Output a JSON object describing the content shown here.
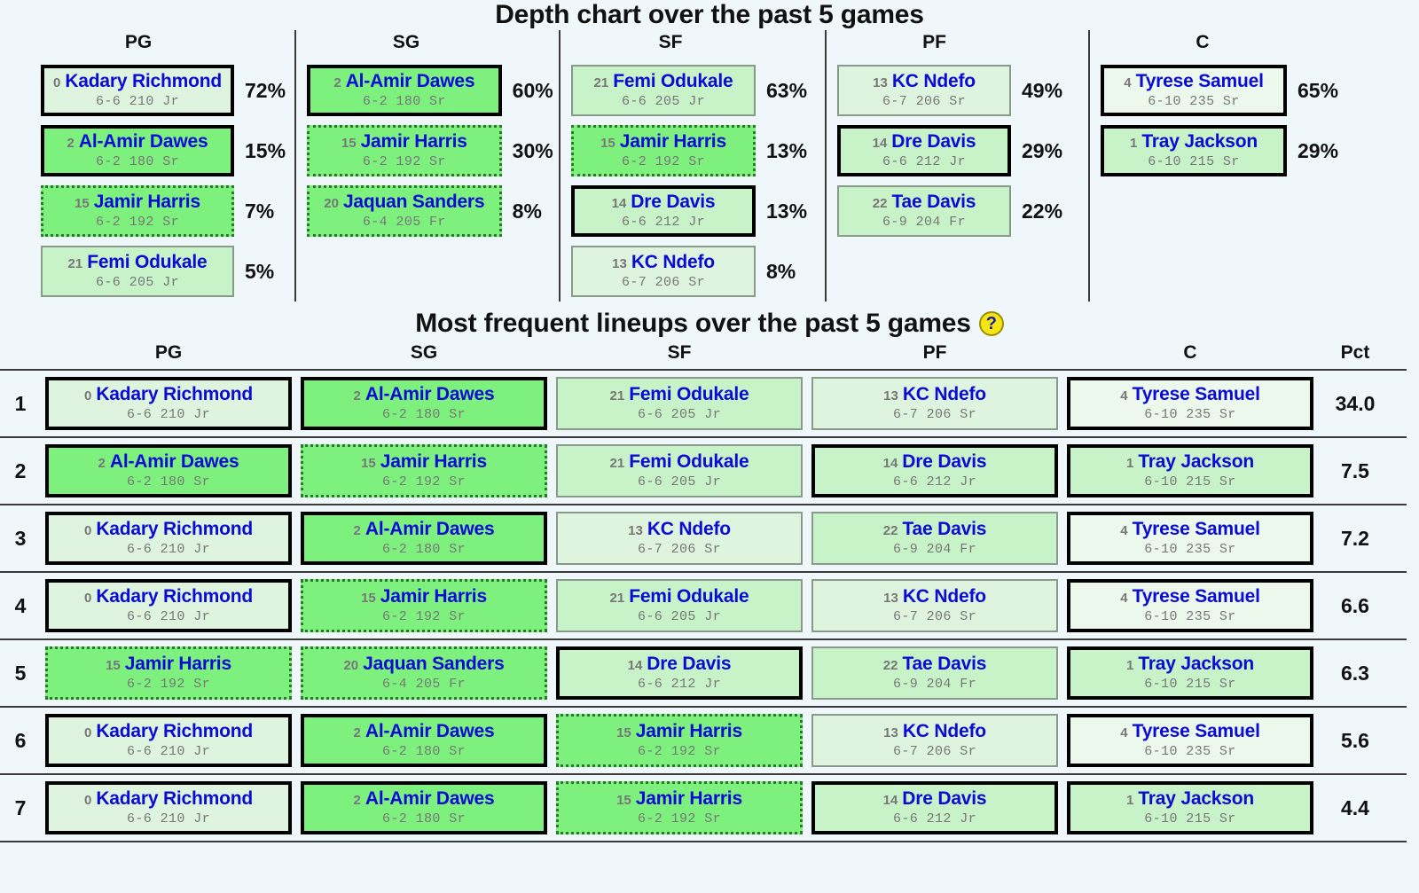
{
  "depth": {
    "title": "Depth chart over the past 5 games",
    "columns": [
      {
        "label": "PG",
        "players": [
          {
            "num": "0",
            "name": "Kadary Richmond",
            "detail": "6-6 210 Jr",
            "pct": "72%",
            "border": "bd-thick",
            "fill": "fill-1"
          },
          {
            "num": "2",
            "name": "Al-Amir Dawes",
            "detail": "6-2 180 Sr",
            "pct": "15%",
            "border": "bd-thick",
            "fill": "fill-3"
          },
          {
            "num": "15",
            "name": "Jamir Harris",
            "detail": "6-2 192 Sr",
            "pct": "7%",
            "border": "bd-dot",
            "fill": "fill-3"
          },
          {
            "num": "21",
            "name": "Femi Odukale",
            "detail": "6-6 205 Jr",
            "pct": "5%",
            "border": "bd-thin",
            "fill": "fill-2"
          }
        ]
      },
      {
        "label": "SG",
        "players": [
          {
            "num": "2",
            "name": "Al-Amir Dawes",
            "detail": "6-2 180 Sr",
            "pct": "60%",
            "border": "bd-thick",
            "fill": "fill-3"
          },
          {
            "num": "15",
            "name": "Jamir Harris",
            "detail": "6-2 192 Sr",
            "pct": "30%",
            "border": "bd-dot",
            "fill": "fill-3"
          },
          {
            "num": "20",
            "name": "Jaquan Sanders",
            "detail": "6-4 205 Fr",
            "pct": "8%",
            "border": "bd-dot",
            "fill": "fill-3"
          }
        ]
      },
      {
        "label": "SF",
        "players": [
          {
            "num": "21",
            "name": "Femi Odukale",
            "detail": "6-6 205 Jr",
            "pct": "63%",
            "border": "bd-thin",
            "fill": "fill-2"
          },
          {
            "num": "15",
            "name": "Jamir Harris",
            "detail": "6-2 192 Sr",
            "pct": "13%",
            "border": "bd-dot",
            "fill": "fill-3"
          },
          {
            "num": "14",
            "name": "Dre Davis",
            "detail": "6-6 212 Jr",
            "pct": "13%",
            "border": "bd-thick",
            "fill": "fill-2"
          },
          {
            "num": "13",
            "name": "KC Ndefo",
            "detail": "6-7 206 Sr",
            "pct": "8%",
            "border": "bd-thin",
            "fill": "fill-1"
          }
        ]
      },
      {
        "label": "PF",
        "players": [
          {
            "num": "13",
            "name": "KC Ndefo",
            "detail": "6-7 206 Sr",
            "pct": "49%",
            "border": "bd-thin",
            "fill": "fill-1"
          },
          {
            "num": "14",
            "name": "Dre Davis",
            "detail": "6-6 212 Jr",
            "pct": "29%",
            "border": "bd-thick",
            "fill": "fill-2"
          },
          {
            "num": "22",
            "name": "Tae Davis",
            "detail": "6-9 204 Fr",
            "pct": "22%",
            "border": "bd-thin",
            "fill": "fill-2"
          }
        ]
      },
      {
        "label": "C",
        "players": [
          {
            "num": "4",
            "name": "Tyrese Samuel",
            "detail": "6-10 235 Sr",
            "pct": "65%",
            "border": "bd-thick",
            "fill": "fill-0"
          },
          {
            "num": "1",
            "name": "Tray Jackson",
            "detail": "6-10 215 Sr",
            "pct": "29%",
            "border": "bd-thick",
            "fill": "fill-2"
          }
        ]
      }
    ]
  },
  "lineups": {
    "title": "Most frequent lineups over the past 5 games",
    "help_icon": "question-mark-icon",
    "help_label": "?",
    "headers": [
      "PG",
      "SG",
      "SF",
      "PF",
      "C"
    ],
    "pct_header": "Pct",
    "rows": [
      {
        "rank": "1",
        "pct": "34.0",
        "slots": [
          {
            "num": "0",
            "name": "Kadary Richmond",
            "detail": "6-6 210 Jr",
            "border": "bd-thick",
            "fill": "fill-1"
          },
          {
            "num": "2",
            "name": "Al-Amir Dawes",
            "detail": "6-2 180 Sr",
            "border": "bd-thick",
            "fill": "fill-3"
          },
          {
            "num": "21",
            "name": "Femi Odukale",
            "detail": "6-6 205 Jr",
            "border": "bd-thin",
            "fill": "fill-2"
          },
          {
            "num": "13",
            "name": "KC Ndefo",
            "detail": "6-7 206 Sr",
            "border": "bd-thin",
            "fill": "fill-1"
          },
          {
            "num": "4",
            "name": "Tyrese Samuel",
            "detail": "6-10 235 Sr",
            "border": "bd-thick",
            "fill": "fill-0"
          }
        ]
      },
      {
        "rank": "2",
        "pct": "7.5",
        "slots": [
          {
            "num": "2",
            "name": "Al-Amir Dawes",
            "detail": "6-2 180 Sr",
            "border": "bd-thick",
            "fill": "fill-3"
          },
          {
            "num": "15",
            "name": "Jamir Harris",
            "detail": "6-2 192 Sr",
            "border": "bd-dot",
            "fill": "fill-3"
          },
          {
            "num": "21",
            "name": "Femi Odukale",
            "detail": "6-6 205 Jr",
            "border": "bd-thin",
            "fill": "fill-2"
          },
          {
            "num": "14",
            "name": "Dre Davis",
            "detail": "6-6 212 Jr",
            "border": "bd-thick",
            "fill": "fill-2"
          },
          {
            "num": "1",
            "name": "Tray Jackson",
            "detail": "6-10 215 Sr",
            "border": "bd-thick",
            "fill": "fill-2"
          }
        ]
      },
      {
        "rank": "3",
        "pct": "7.2",
        "slots": [
          {
            "num": "0",
            "name": "Kadary Richmond",
            "detail": "6-6 210 Jr",
            "border": "bd-thick",
            "fill": "fill-1"
          },
          {
            "num": "2",
            "name": "Al-Amir Dawes",
            "detail": "6-2 180 Sr",
            "border": "bd-thick",
            "fill": "fill-3"
          },
          {
            "num": "13",
            "name": "KC Ndefo",
            "detail": "6-7 206 Sr",
            "border": "bd-thin",
            "fill": "fill-1"
          },
          {
            "num": "22",
            "name": "Tae Davis",
            "detail": "6-9 204 Fr",
            "border": "bd-thin",
            "fill": "fill-2"
          },
          {
            "num": "4",
            "name": "Tyrese Samuel",
            "detail": "6-10 235 Sr",
            "border": "bd-thick",
            "fill": "fill-0"
          }
        ]
      },
      {
        "rank": "4",
        "pct": "6.6",
        "slots": [
          {
            "num": "0",
            "name": "Kadary Richmond",
            "detail": "6-6 210 Jr",
            "border": "bd-thick",
            "fill": "fill-1"
          },
          {
            "num": "15",
            "name": "Jamir Harris",
            "detail": "6-2 192 Sr",
            "border": "bd-dot",
            "fill": "fill-3"
          },
          {
            "num": "21",
            "name": "Femi Odukale",
            "detail": "6-6 205 Jr",
            "border": "bd-thin",
            "fill": "fill-2"
          },
          {
            "num": "13",
            "name": "KC Ndefo",
            "detail": "6-7 206 Sr",
            "border": "bd-thin",
            "fill": "fill-1"
          },
          {
            "num": "4",
            "name": "Tyrese Samuel",
            "detail": "6-10 235 Sr",
            "border": "bd-thick",
            "fill": "fill-0"
          }
        ]
      },
      {
        "rank": "5",
        "pct": "6.3",
        "slots": [
          {
            "num": "15",
            "name": "Jamir Harris",
            "detail": "6-2 192 Sr",
            "border": "bd-dot",
            "fill": "fill-3"
          },
          {
            "num": "20",
            "name": "Jaquan Sanders",
            "detail": "6-4 205 Fr",
            "border": "bd-dot",
            "fill": "fill-3"
          },
          {
            "num": "14",
            "name": "Dre Davis",
            "detail": "6-6 212 Jr",
            "border": "bd-thick",
            "fill": "fill-2"
          },
          {
            "num": "22",
            "name": "Tae Davis",
            "detail": "6-9 204 Fr",
            "border": "bd-thin",
            "fill": "fill-2"
          },
          {
            "num": "1",
            "name": "Tray Jackson",
            "detail": "6-10 215 Sr",
            "border": "bd-thick",
            "fill": "fill-2"
          }
        ]
      },
      {
        "rank": "6",
        "pct": "5.6",
        "slots": [
          {
            "num": "0",
            "name": "Kadary Richmond",
            "detail": "6-6 210 Jr",
            "border": "bd-thick",
            "fill": "fill-1"
          },
          {
            "num": "2",
            "name": "Al-Amir Dawes",
            "detail": "6-2 180 Sr",
            "border": "bd-thick",
            "fill": "fill-3"
          },
          {
            "num": "15",
            "name": "Jamir Harris",
            "detail": "6-2 192 Sr",
            "border": "bd-dot",
            "fill": "fill-3"
          },
          {
            "num": "13",
            "name": "KC Ndefo",
            "detail": "6-7 206 Sr",
            "border": "bd-thin",
            "fill": "fill-1"
          },
          {
            "num": "4",
            "name": "Tyrese Samuel",
            "detail": "6-10 235 Sr",
            "border": "bd-thick",
            "fill": "fill-0"
          }
        ]
      },
      {
        "rank": "7",
        "pct": "4.4",
        "slots": [
          {
            "num": "0",
            "name": "Kadary Richmond",
            "detail": "6-6 210 Jr",
            "border": "bd-thick",
            "fill": "fill-1"
          },
          {
            "num": "2",
            "name": "Al-Amir Dawes",
            "detail": "6-2 180 Sr",
            "border": "bd-thick",
            "fill": "fill-3"
          },
          {
            "num": "15",
            "name": "Jamir Harris",
            "detail": "6-2 192 Sr",
            "border": "bd-dot",
            "fill": "fill-3"
          },
          {
            "num": "14",
            "name": "Dre Davis",
            "detail": "6-6 212 Jr",
            "border": "bd-thick",
            "fill": "fill-2"
          },
          {
            "num": "1",
            "name": "Tray Jackson",
            "detail": "6-10 215 Sr",
            "border": "bd-thick",
            "fill": "fill-2"
          }
        ]
      }
    ]
  },
  "colors": {
    "page_background": "#f0f7fb",
    "player_name": "#0b0bd6",
    "detail_text": "#777777",
    "fill_low": "#edf8ed",
    "fill_mid": "#c8f2c8",
    "fill_high": "#7ef07e",
    "help_icon_background": "#f5e614",
    "help_icon_glyph": "#1a1aa8"
  }
}
